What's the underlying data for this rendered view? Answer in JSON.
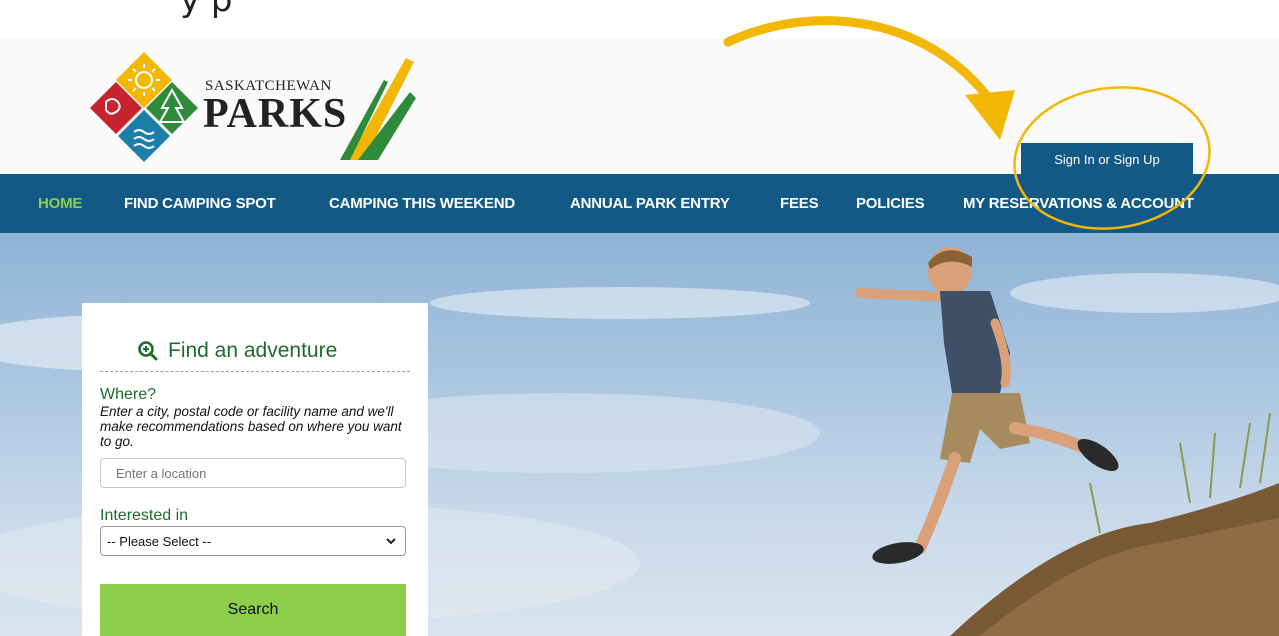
{
  "caption": {
    "partial_text": "y                                              p"
  },
  "brand": {
    "name_small": "SASKATCHEWAN",
    "name_big": "PARKS",
    "colors": {
      "red": "#c8242f",
      "yellow": "#f2b705",
      "green": "#2d8b3a",
      "blue": "#1b7fa8"
    }
  },
  "header": {
    "signin_label": "Sign In or Sign Up"
  },
  "nav": {
    "items": [
      {
        "label": "HOME",
        "active": true
      },
      {
        "label": "FIND CAMPING SPOT",
        "active": false
      },
      {
        "label": "CAMPING THIS WEEKEND",
        "active": false
      },
      {
        "label": "ANNUAL PARK ENTRY",
        "active": false
      },
      {
        "label": "FEES",
        "active": false
      },
      {
        "label": "POLICIES",
        "active": false
      },
      {
        "label": "MY RESERVATIONS & ACCOUNT",
        "active": false
      }
    ],
    "background": "#125985",
    "active_color": "#8fce4c"
  },
  "search_panel": {
    "title": "Find an adventure",
    "title_icon": "magnifier-plus-icon",
    "where_label": "Where?",
    "where_help": "Enter a city, postal code or facility name and we'll make recommendations based on where you want to go.",
    "location_placeholder": "Enter a location",
    "interested_label": "Interested in",
    "interested_selected": "-- Please Select --",
    "search_label": "Search",
    "accent_green": "#1f6b2e",
    "button_color": "#8ccd4b"
  },
  "annotation": {
    "color": "#f2b705"
  }
}
